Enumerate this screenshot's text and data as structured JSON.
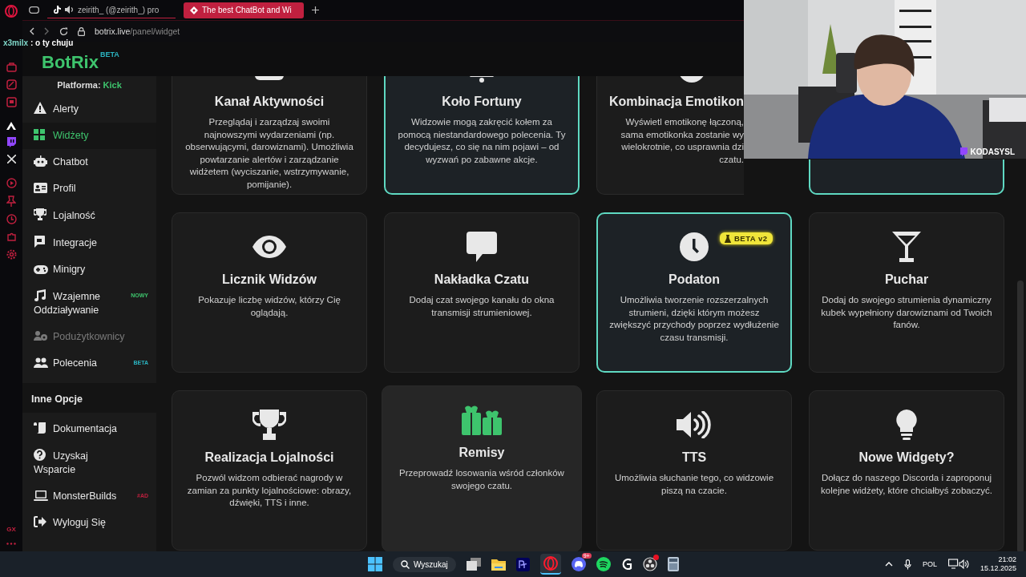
{
  "browser": {
    "tabs": [
      {
        "title": "zeirith_ (@zeirith_) pro",
        "selected": false,
        "audio": true
      },
      {
        "title": "The best ChatBot and Wi",
        "selected": true,
        "audio": false
      }
    ],
    "address": {
      "host": "botrix.live",
      "path": "/panel/widget"
    }
  },
  "chat_overlay": {
    "user": "x3milx",
    "message": ": o ty chuju"
  },
  "opera_sidebar": {
    "label": "GX"
  },
  "logo": {
    "name": "BotRix",
    "badge": "BETA"
  },
  "platform": {
    "label": "Platforma:",
    "value": "Kick"
  },
  "nav": [
    {
      "label": "Alerty",
      "selected": false,
      "disabled": false
    },
    {
      "label": "Widżety",
      "selected": true,
      "disabled": false
    },
    {
      "label": "Chatbot",
      "selected": false,
      "disabled": false
    },
    {
      "label": "Profil",
      "selected": false,
      "disabled": false
    },
    {
      "label": "Lojalność",
      "selected": false,
      "disabled": false
    },
    {
      "label": "Integracje",
      "selected": false,
      "disabled": false
    },
    {
      "label": "Minigry",
      "selected": false,
      "disabled": false
    },
    {
      "label": "Wzajemne Oddziaływanie",
      "selected": false,
      "disabled": false,
      "badge": {
        "text": "NOWY",
        "color": "#3ec46d"
      }
    },
    {
      "label": "Podużytkownicy",
      "selected": false,
      "disabled": true
    },
    {
      "label": "Polecenia",
      "selected": false,
      "disabled": false,
      "badge": {
        "text": "BETA",
        "color": "#2bb3c0"
      }
    }
  ],
  "section": "Inne Opcje",
  "other": [
    {
      "label": "Dokumentacja"
    },
    {
      "label": "Uzyskaj Wsparcie"
    },
    {
      "label": "MonsterBuilds",
      "badge": {
        "text": "#AD",
        "color": "#c0203f"
      }
    },
    {
      "label": "Wyloguj Się"
    }
  ],
  "cards": [
    {
      "kind": "full",
      "title": "Kanał Aktywności",
      "description": "Przeglądaj i zarządzaj swoimi najnowszymi wydarzeniami (np. obserwującymi, darowiznami). Umożliwia powtarzanie alertów i zarządzanie widżetem (wyciszanie, wstrzymywanie, pomijanie).",
      "highlighted": false,
      "hovered": false
    },
    {
      "kind": "full",
      "title": "Koło Fortuny",
      "description": "Widzowie mogą zakręcić kołem za pomocą niestandardowego polecenia. Ty decydujesz, co się na nim pojawi – od wyzwań po zabawne akcje.",
      "highlighted": true,
      "hovered": false
    },
    {
      "kind": "partial",
      "title": "Kombinacja Emotikon",
      "description": "Wyświetl emotikonę łączoną,\nsama emotikonka zostanie wy\nwielokrotnie, co usprawnia dzi\nczatu.",
      "highlighted": false,
      "hovered": false
    },
    {
      "kind": "covered",
      "highlighted": true,
      "hovered": false
    },
    {
      "kind": "full",
      "title": "Licznik Widzów",
      "description": "Pokazuje liczbę widzów, którzy Cię oglądają.",
      "highlighted": false,
      "hovered": false
    },
    {
      "kind": "full",
      "title": "Nakładka Czatu",
      "description": "Dodaj czat swojego kanału do okna transmisji strumieniowej.",
      "highlighted": false,
      "hovered": false
    },
    {
      "kind": "full",
      "title": "Podaton",
      "badge": "BETA v2",
      "description": "Umożliwia tworzenie rozszerzalnych strumieni, dzięki którym możesz zwiększyć przychody poprzez wydłużenie czasu transmisji.",
      "highlighted": true,
      "hovered": false
    },
    {
      "kind": "full",
      "title": "Puchar",
      "description": "Dodaj do swojego strumienia dynamiczny kubek wypełniony darowiznami od Twoich fanów.",
      "highlighted": false,
      "hovered": false
    },
    {
      "kind": "full",
      "title": "Realizacja Lojalności",
      "description": "Pozwól widzom odbierać nagrody w zamian za punkty lojalnościowe: obrazy, dźwięki, TTS i inne.",
      "highlighted": false,
      "hovered": false
    },
    {
      "kind": "full",
      "title": "Remisy",
      "description": "Przeprowadź losowania wśród członków swojego czatu.",
      "highlighted": false,
      "hovered": true
    },
    {
      "kind": "full",
      "title": "TTS",
      "description": "Umożliwia słuchanie tego, co widzowie piszą na czacie.",
      "highlighted": false,
      "hovered": false
    },
    {
      "kind": "full",
      "title": "Nowe Widgety?",
      "description": "Dołącz do naszego Discorda i zaproponuj kolejne widżety, które chciałbyś zobaczyć.",
      "highlighted": false,
      "hovered": false
    }
  ],
  "webcam": {
    "kind": "picture",
    "channel": "KODASYSL"
  },
  "taskbar": {
    "search": "Wyszukaj",
    "notification": "9+",
    "language": "POL",
    "time": "21:02",
    "date": "15.12.2025"
  }
}
